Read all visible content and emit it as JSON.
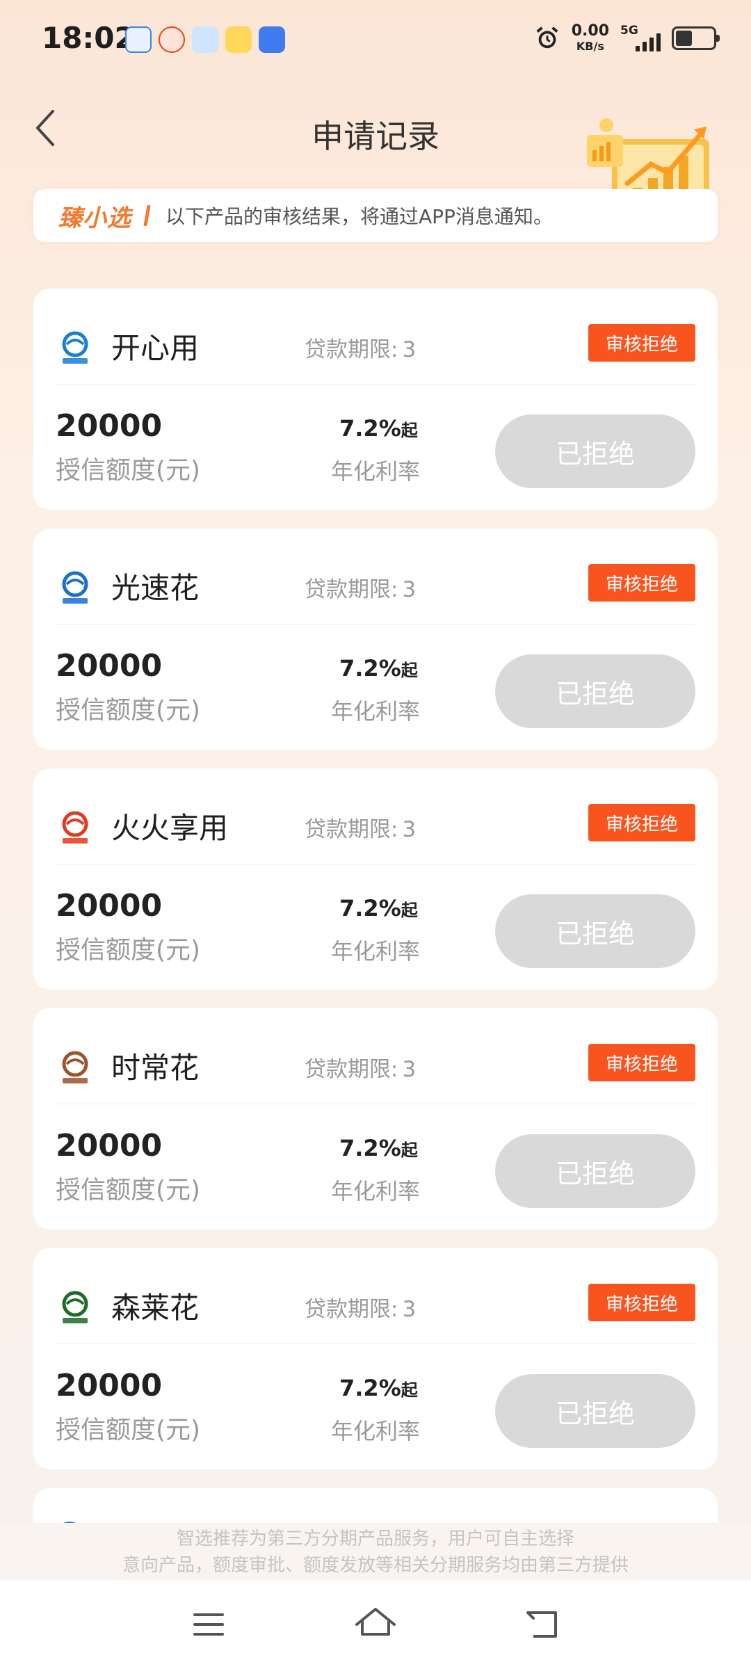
{
  "status_bar": {
    "time": "18:02",
    "net_speed_value": "0.00",
    "net_speed_unit": "KB/s",
    "network_type": "5G",
    "notification_icons": [
      "app-notification-icon-1",
      "app-notification-icon-2",
      "app-notification-icon-3",
      "app-notification-icon-4",
      "app-notification-icon-5"
    ]
  },
  "header": {
    "title": "申请记录",
    "back_icon": "chevron-left-icon"
  },
  "notice": {
    "brand": "臻小选",
    "text": "以下产品的审核结果，将通过APP消息通知。"
  },
  "labels": {
    "term_label": "贷款期限:",
    "amount_label": "授信额度(元)",
    "rate_suffix": "起",
    "rate_label": "年化利率"
  },
  "records": [
    {
      "name": "开心用",
      "term": "3",
      "status": "审核拒绝",
      "amount": "20000",
      "rate": "7.2%",
      "action": "已拒绝",
      "logo_text": "开心用",
      "logo_color": "#1a7fd4"
    },
    {
      "name": "光速花",
      "term": "3",
      "status": "审核拒绝",
      "amount": "20000",
      "rate": "7.2%",
      "action": "已拒绝",
      "logo_text": "光速花",
      "logo_color": "#1a6fd0"
    },
    {
      "name": "火火享用",
      "term": "3",
      "status": "审核拒绝",
      "amount": "20000",
      "rate": "7.2%",
      "action": "已拒绝",
      "logo_text": "火火享用",
      "logo_color": "#e23a1e"
    },
    {
      "name": "时常花",
      "term": "3",
      "status": "审核拒绝",
      "amount": "20000",
      "rate": "7.2%",
      "action": "已拒绝",
      "logo_text": "时常花",
      "logo_color": "#a0522d"
    },
    {
      "name": "森莱花",
      "term": "3",
      "status": "审核拒绝",
      "amount": "20000",
      "rate": "7.2%",
      "action": "已拒绝",
      "logo_text": "森莱花",
      "logo_color": "#1e6b2a"
    }
  ],
  "disclaimer": {
    "line1": "智选推荐为第三方分期产品服务，用户可自主选择",
    "line2": "意向产品，额度审批、额度发放等相关分期服务均由第三方提供"
  },
  "navbar": {
    "menu_icon": "menu-icon",
    "home_icon": "home-icon",
    "back_icon": "back-icon"
  },
  "colors": {
    "status_badge": "#f9541e",
    "brand_orange": "#f37a30",
    "disabled_button": "#d9d9d9"
  }
}
